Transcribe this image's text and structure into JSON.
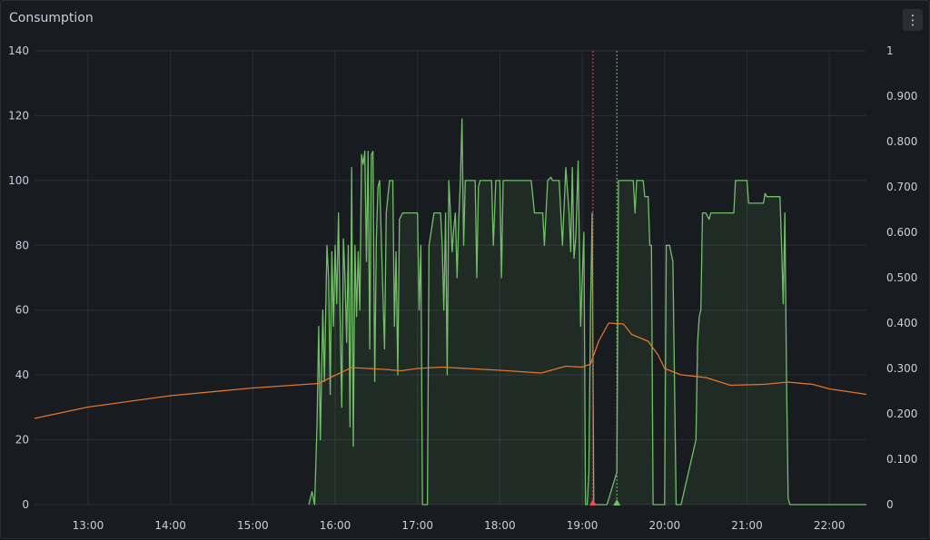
{
  "panel": {
    "title": "Consumption",
    "menu_icon": "kebab-menu-icon",
    "menu_glyph": "⋮"
  },
  "chart_data": {
    "type": "line",
    "title": "Consumption",
    "grid": true,
    "legend": "none",
    "x_unit": "hour of day",
    "xlim": [
      12.35,
      22.45
    ],
    "x_ticks": [
      {
        "v": 13,
        "label": "13:00"
      },
      {
        "v": 14,
        "label": "14:00"
      },
      {
        "v": 15,
        "label": "15:00"
      },
      {
        "v": 16,
        "label": "16:00"
      },
      {
        "v": 17,
        "label": "17:00"
      },
      {
        "v": 18,
        "label": "18:00"
      },
      {
        "v": 19,
        "label": "19:00"
      },
      {
        "v": 20,
        "label": "20:00"
      },
      {
        "v": 21,
        "label": "21:00"
      },
      {
        "v": 22,
        "label": "22:00"
      }
    ],
    "y_left": {
      "range": [
        0,
        140
      ],
      "ticks": [
        {
          "v": 0,
          "label": "0"
        },
        {
          "v": 20,
          "label": "20"
        },
        {
          "v": 40,
          "label": "40"
        },
        {
          "v": 60,
          "label": "60"
        },
        {
          "v": 80,
          "label": "80"
        },
        {
          "v": 100,
          "label": "100"
        },
        {
          "v": 120,
          "label": "120"
        },
        {
          "v": 140,
          "label": "140"
        }
      ]
    },
    "y_right": {
      "range": [
        0,
        1
      ],
      "ticks": [
        {
          "v": 0,
          "label": "0"
        },
        {
          "v": 0.1,
          "label": "0.100"
        },
        {
          "v": 0.2,
          "label": "0.200"
        },
        {
          "v": 0.3,
          "label": "0.300"
        },
        {
          "v": 0.4,
          "label": "0.400"
        },
        {
          "v": 0.5,
          "label": "0.500"
        },
        {
          "v": 0.6,
          "label": "0.600"
        },
        {
          "v": 0.7,
          "label": "0.700"
        },
        {
          "v": 0.8,
          "label": "0.800"
        },
        {
          "v": 0.9,
          "label": "0.900"
        },
        {
          "v": 1,
          "label": "1"
        }
      ]
    },
    "annotations": [
      {
        "x": 19.13,
        "color": "#f2495c"
      },
      {
        "x": 19.42,
        "color": "#73bf69"
      }
    ],
    "series": [
      {
        "axis": "left",
        "color": "#73bf69",
        "fill": true,
        "points": [
          [
            15.68,
            0
          ],
          [
            15.72,
            4
          ],
          [
            15.75,
            0
          ],
          [
            15.78,
            25
          ],
          [
            15.8,
            55
          ],
          [
            15.82,
            20
          ],
          [
            15.85,
            60
          ],
          [
            15.87,
            38
          ],
          [
            15.9,
            80
          ],
          [
            15.92,
            70
          ],
          [
            15.94,
            34
          ],
          [
            15.96,
            78
          ],
          [
            15.98,
            55
          ],
          [
            16.0,
            80
          ],
          [
            16.02,
            62
          ],
          [
            16.04,
            90
          ],
          [
            16.06,
            58
          ],
          [
            16.08,
            30
          ],
          [
            16.1,
            82
          ],
          [
            16.12,
            70
          ],
          [
            16.14,
            50
          ],
          [
            16.16,
            80
          ],
          [
            16.18,
            24
          ],
          [
            16.2,
            104
          ],
          [
            16.22,
            18
          ],
          [
            16.24,
            80
          ],
          [
            16.26,
            58
          ],
          [
            16.28,
            78
          ],
          [
            16.3,
            60
          ],
          [
            16.32,
            108
          ],
          [
            16.34,
            105
          ],
          [
            16.36,
            109
          ],
          [
            16.38,
            75
          ],
          [
            16.4,
            109
          ],
          [
            16.42,
            48
          ],
          [
            16.44,
            108
          ],
          [
            16.46,
            109
          ],
          [
            16.48,
            38
          ],
          [
            16.5,
            82
          ],
          [
            16.52,
            98
          ],
          [
            16.54,
            100
          ],
          [
            16.6,
            48
          ],
          [
            16.62,
            90
          ],
          [
            16.66,
            100
          ],
          [
            16.7,
            100
          ],
          [
            16.72,
            55
          ],
          [
            16.74,
            78
          ],
          [
            16.76,
            40
          ],
          [
            16.78,
            88
          ],
          [
            16.82,
            90
          ],
          [
            17.0,
            90
          ],
          [
            17.02,
            60
          ],
          [
            17.04,
            80
          ],
          [
            17.06,
            0
          ],
          [
            17.12,
            0
          ],
          [
            17.14,
            80
          ],
          [
            17.2,
            90
          ],
          [
            17.28,
            90
          ],
          [
            17.3,
            80
          ],
          [
            17.32,
            60
          ],
          [
            17.34,
            90
          ],
          [
            17.36,
            40
          ],
          [
            17.38,
            100
          ],
          [
            17.4,
            90
          ],
          [
            17.42,
            78
          ],
          [
            17.44,
            85
          ],
          [
            17.46,
            90
          ],
          [
            17.48,
            70
          ],
          [
            17.5,
            88
          ],
          [
            17.52,
            100
          ],
          [
            17.54,
            119
          ],
          [
            17.56,
            80
          ],
          [
            17.58,
            100
          ],
          [
            17.7,
            100
          ],
          [
            17.72,
            70
          ],
          [
            17.74,
            98
          ],
          [
            17.76,
            100
          ],
          [
            17.9,
            100
          ],
          [
            17.92,
            80
          ],
          [
            17.95,
            100
          ],
          [
            18.0,
            100
          ],
          [
            18.02,
            70
          ],
          [
            18.04,
            100
          ],
          [
            18.38,
            100
          ],
          [
            18.42,
            90
          ],
          [
            18.52,
            90
          ],
          [
            18.54,
            80
          ],
          [
            18.58,
            100
          ],
          [
            18.62,
            101
          ],
          [
            18.64,
            100
          ],
          [
            18.72,
            100
          ],
          [
            18.76,
            80
          ],
          [
            18.8,
            104
          ],
          [
            18.84,
            90
          ],
          [
            18.86,
            78
          ],
          [
            18.88,
            104
          ],
          [
            18.9,
            76
          ],
          [
            18.92,
            82
          ],
          [
            18.95,
            106
          ],
          [
            18.98,
            55
          ],
          [
            19.02,
            84
          ],
          [
            19.04,
            0
          ],
          [
            19.06,
            0
          ],
          [
            19.08,
            10
          ],
          [
            19.1,
            60
          ],
          [
            19.12,
            90
          ],
          [
            19.14,
            0
          ],
          [
            19.3,
            0
          ],
          [
            19.42,
            10
          ],
          [
            19.44,
            100
          ],
          [
            19.62,
            100
          ],
          [
            19.64,
            90
          ],
          [
            19.66,
            100
          ],
          [
            19.74,
            100
          ],
          [
            19.76,
            95
          ],
          [
            19.8,
            95
          ],
          [
            19.82,
            80
          ],
          [
            19.84,
            80
          ],
          [
            19.86,
            0
          ],
          [
            19.92,
            0
          ],
          [
            20.0,
            0
          ],
          [
            20.02,
            80
          ],
          [
            20.06,
            80
          ],
          [
            20.1,
            75
          ],
          [
            20.14,
            0
          ],
          [
            20.2,
            0
          ],
          [
            20.38,
            20
          ],
          [
            20.4,
            50
          ],
          [
            20.42,
            58
          ],
          [
            20.44,
            60
          ],
          [
            20.46,
            90
          ],
          [
            20.5,
            90
          ],
          [
            20.54,
            88
          ],
          [
            20.56,
            90
          ],
          [
            20.84,
            90
          ],
          [
            20.86,
            100
          ],
          [
            21.0,
            100
          ],
          [
            21.02,
            93
          ],
          [
            21.2,
            93
          ],
          [
            21.22,
            96
          ],
          [
            21.24,
            95
          ],
          [
            21.4,
            95
          ],
          [
            21.42,
            80
          ],
          [
            21.44,
            62
          ],
          [
            21.46,
            90
          ],
          [
            21.48,
            40
          ],
          [
            21.5,
            2
          ],
          [
            21.52,
            0
          ],
          [
            22.45,
            0
          ]
        ]
      },
      {
        "axis": "right",
        "color": "#e0752d",
        "fill": false,
        "points": [
          [
            12.35,
            0.19
          ],
          [
            13.0,
            0.215
          ],
          [
            14.0,
            0.24
          ],
          [
            15.0,
            0.257
          ],
          [
            15.8,
            0.267
          ],
          [
            16.0,
            0.285
          ],
          [
            16.2,
            0.302
          ],
          [
            16.6,
            0.298
          ],
          [
            16.8,
            0.295
          ],
          [
            17.0,
            0.3
          ],
          [
            17.3,
            0.303
          ],
          [
            17.6,
            0.3
          ],
          [
            18.0,
            0.296
          ],
          [
            18.5,
            0.29
          ],
          [
            18.8,
            0.305
          ],
          [
            19.0,
            0.303
          ],
          [
            19.1,
            0.31
          ],
          [
            19.2,
            0.36
          ],
          [
            19.32,
            0.4
          ],
          [
            19.5,
            0.398
          ],
          [
            19.6,
            0.375
          ],
          [
            19.8,
            0.36
          ],
          [
            19.92,
            0.33
          ],
          [
            20.0,
            0.3
          ],
          [
            20.2,
            0.286
          ],
          [
            20.5,
            0.28
          ],
          [
            20.8,
            0.263
          ],
          [
            21.2,
            0.265
          ],
          [
            21.5,
            0.27
          ],
          [
            21.8,
            0.265
          ],
          [
            22.0,
            0.255
          ],
          [
            22.45,
            0.243
          ]
        ]
      }
    ]
  }
}
